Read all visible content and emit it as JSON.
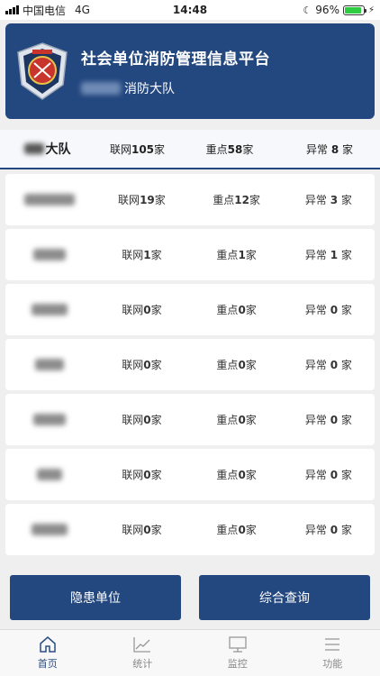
{
  "status_bar": {
    "carrier": "中国电信",
    "network": "4G",
    "time": "14:48",
    "battery": "96%"
  },
  "header": {
    "title": "社会单位消防管理信息平台",
    "subtitle_suffix": "消防大队"
  },
  "summary": {
    "name_suffix": "大队",
    "connected": {
      "prefix": "联网",
      "value": "105",
      "unit": "家"
    },
    "key": {
      "prefix": "重点",
      "value": "58",
      "unit": "家"
    },
    "abnormal": {
      "prefix": "异常 ",
      "value": "8",
      "unit": " 家"
    }
  },
  "rows": [
    {
      "connected": "19",
      "key": "12",
      "abnormal": "3"
    },
    {
      "connected": "1",
      "key": "1",
      "abnormal": "1"
    },
    {
      "connected": "0",
      "key": "0",
      "abnormal": "0"
    },
    {
      "connected": "0",
      "key": "0",
      "abnormal": "0"
    },
    {
      "connected": "0",
      "key": "0",
      "abnormal": "0"
    },
    {
      "connected": "0",
      "key": "0",
      "abnormal": "0"
    },
    {
      "connected": "0",
      "key": "0",
      "abnormal": "0"
    }
  ],
  "labels": {
    "connected_prefix": "联网",
    "key_prefix": "重点",
    "abnormal_prefix": "异常 ",
    "unit": "家",
    "abnormal_unit": " 家"
  },
  "buttons": {
    "hazard_units": "隐患单位",
    "comprehensive_query": "综合查询"
  },
  "tabs": [
    {
      "label": "首页",
      "icon": "home-icon",
      "active": true
    },
    {
      "label": "统计",
      "icon": "chart-icon",
      "active": false
    },
    {
      "label": "监控",
      "icon": "monitor-icon",
      "active": false
    },
    {
      "label": "功能",
      "icon": "menu-icon",
      "active": false
    }
  ],
  "colors": {
    "primary": "#23477f",
    "battery": "#2ecc40"
  }
}
